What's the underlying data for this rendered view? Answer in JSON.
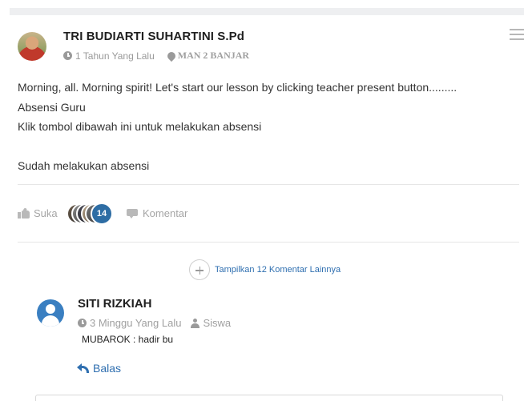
{
  "post": {
    "author": "TRI BUDIARTI SUHARTINI S.Pd",
    "time": "1 Tahun Yang Lalu",
    "school": "MAN 2 BANJAR",
    "body_lines": [
      "Morning, all. Morning spirit! Let's start our lesson by clicking teacher present button.........",
      "Absensi Guru",
      "Klik tombol dibawah ini untuk melakukan absensi",
      "",
      "Sudah melakukan absensi"
    ]
  },
  "actions": {
    "like_label": "Suka",
    "like_count": "14",
    "comment_label": "Komentar"
  },
  "show_more": {
    "label": "Tampilkan 12 Komentar Lainnya"
  },
  "comment": {
    "author": "SITI RIZKIAH",
    "time": "3 Minggu Yang Lalu",
    "role": "Siswa",
    "text": "MUBAROK : hadir bu",
    "reply_label": "Balas"
  },
  "colors": {
    "link_blue": "#2f6fb0",
    "badge_blue": "#2e6da4",
    "muted_gray": "#a5a5a5"
  },
  "icons": [
    "clock-icon",
    "map-pin-icon",
    "menu-icon",
    "thumbs-up-icon",
    "comment-icon",
    "plus-icon",
    "user-icon",
    "person-icon",
    "reply-icon"
  ]
}
